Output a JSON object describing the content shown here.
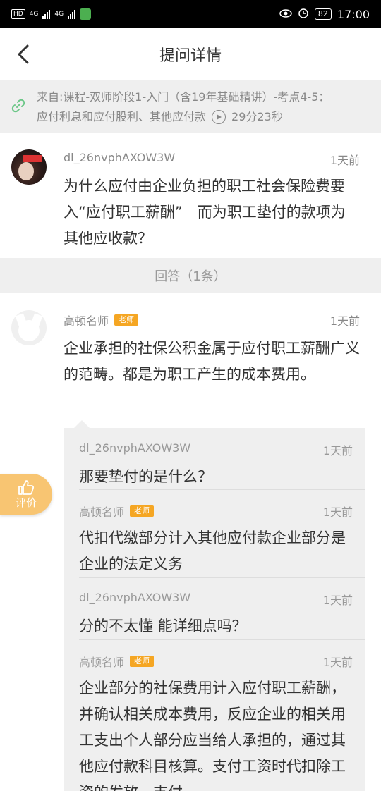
{
  "status_bar": {
    "time": "17:00",
    "battery": "82",
    "network": "4G",
    "net_badge": "HD"
  },
  "header": {
    "title": "提问详情",
    "back_icon": "chevron-left-icon"
  },
  "source": {
    "line1": "来自:课程-双师阶段1-入门（含19年基础精讲）-考点4-5：",
    "line2": "应付利息和应付股利、其他应付款",
    "duration": "29分23秒",
    "link_icon": "link-icon",
    "play_icon": "play-icon"
  },
  "question": {
    "user": "dl_26nvphAXOW3W",
    "time": "1天前",
    "text": "为什么应付由企业负担的职工社会保险费要入“应付职工薪酬”　而为职工垫付的款项为其他应收款？"
  },
  "answers_header": "回答（1条）",
  "answer": {
    "user": "高顿名师",
    "badge": "老师",
    "time": "1天前",
    "text": "企业承担的社保公积金属于应付职工薪酬广义的范畴。都是为职工产生的成本费用。"
  },
  "followups": [
    {
      "user": "dl_26nvphAXOW3W",
      "badge": "",
      "time": "1天前",
      "text": "那要垫付的是什么？"
    },
    {
      "user": "高顿名师",
      "badge": "老师",
      "time": "1天前",
      "text": "代扣代缴部分计入其他应付款企业部分是企业的法定义务"
    },
    {
      "user": "dl_26nvphAXOW3W",
      "badge": "",
      "time": "1天前",
      "text": "分的不太懂 能详细点吗？"
    },
    {
      "user": "高顿名师",
      "badge": "老师",
      "time": "1天前",
      "text": "企业部分的社保费用计入应付职工薪酬，并确认相关成本费用，反应企业的相关用工支出个人部分应当给人承担的，通过其他应付款科目核算。支付工资时代扣除工资的发放，支付"
    }
  ],
  "rate_button": {
    "label": "评价",
    "icon": "thumbs-up-icon"
  },
  "colors": {
    "accent": "#f5a623",
    "rate_bg": "#f8c572",
    "link_green": "#6cc788",
    "grey_bg": "#efefef"
  }
}
